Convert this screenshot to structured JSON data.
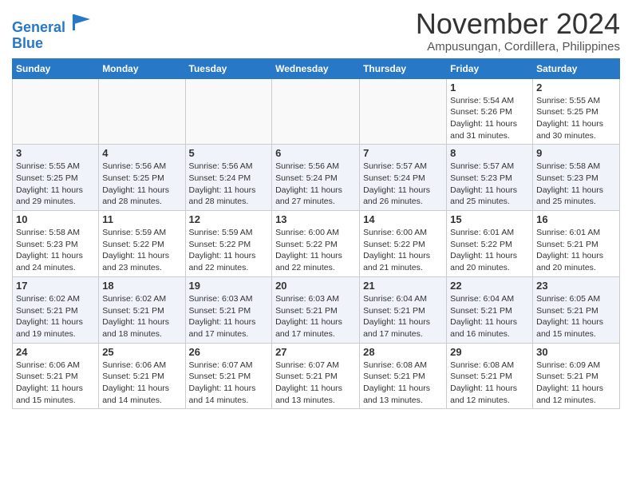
{
  "header": {
    "logo_line1": "General",
    "logo_line2": "Blue",
    "month": "November 2024",
    "location": "Ampusungan, Cordillera, Philippines"
  },
  "days_of_week": [
    "Sunday",
    "Monday",
    "Tuesday",
    "Wednesday",
    "Thursday",
    "Friday",
    "Saturday"
  ],
  "weeks": [
    [
      {
        "day": "",
        "info": ""
      },
      {
        "day": "",
        "info": ""
      },
      {
        "day": "",
        "info": ""
      },
      {
        "day": "",
        "info": ""
      },
      {
        "day": "",
        "info": ""
      },
      {
        "day": "1",
        "info": "Sunrise: 5:54 AM\nSunset: 5:26 PM\nDaylight: 11 hours\nand 31 minutes."
      },
      {
        "day": "2",
        "info": "Sunrise: 5:55 AM\nSunset: 5:25 PM\nDaylight: 11 hours\nand 30 minutes."
      }
    ],
    [
      {
        "day": "3",
        "info": "Sunrise: 5:55 AM\nSunset: 5:25 PM\nDaylight: 11 hours\nand 29 minutes."
      },
      {
        "day": "4",
        "info": "Sunrise: 5:56 AM\nSunset: 5:25 PM\nDaylight: 11 hours\nand 28 minutes."
      },
      {
        "day": "5",
        "info": "Sunrise: 5:56 AM\nSunset: 5:24 PM\nDaylight: 11 hours\nand 28 minutes."
      },
      {
        "day": "6",
        "info": "Sunrise: 5:56 AM\nSunset: 5:24 PM\nDaylight: 11 hours\nand 27 minutes."
      },
      {
        "day": "7",
        "info": "Sunrise: 5:57 AM\nSunset: 5:24 PM\nDaylight: 11 hours\nand 26 minutes."
      },
      {
        "day": "8",
        "info": "Sunrise: 5:57 AM\nSunset: 5:23 PM\nDaylight: 11 hours\nand 25 minutes."
      },
      {
        "day": "9",
        "info": "Sunrise: 5:58 AM\nSunset: 5:23 PM\nDaylight: 11 hours\nand 25 minutes."
      }
    ],
    [
      {
        "day": "10",
        "info": "Sunrise: 5:58 AM\nSunset: 5:23 PM\nDaylight: 11 hours\nand 24 minutes."
      },
      {
        "day": "11",
        "info": "Sunrise: 5:59 AM\nSunset: 5:22 PM\nDaylight: 11 hours\nand 23 minutes."
      },
      {
        "day": "12",
        "info": "Sunrise: 5:59 AM\nSunset: 5:22 PM\nDaylight: 11 hours\nand 22 minutes."
      },
      {
        "day": "13",
        "info": "Sunrise: 6:00 AM\nSunset: 5:22 PM\nDaylight: 11 hours\nand 22 minutes."
      },
      {
        "day": "14",
        "info": "Sunrise: 6:00 AM\nSunset: 5:22 PM\nDaylight: 11 hours\nand 21 minutes."
      },
      {
        "day": "15",
        "info": "Sunrise: 6:01 AM\nSunset: 5:22 PM\nDaylight: 11 hours\nand 20 minutes."
      },
      {
        "day": "16",
        "info": "Sunrise: 6:01 AM\nSunset: 5:21 PM\nDaylight: 11 hours\nand 20 minutes."
      }
    ],
    [
      {
        "day": "17",
        "info": "Sunrise: 6:02 AM\nSunset: 5:21 PM\nDaylight: 11 hours\nand 19 minutes."
      },
      {
        "day": "18",
        "info": "Sunrise: 6:02 AM\nSunset: 5:21 PM\nDaylight: 11 hours\nand 18 minutes."
      },
      {
        "day": "19",
        "info": "Sunrise: 6:03 AM\nSunset: 5:21 PM\nDaylight: 11 hours\nand 17 minutes."
      },
      {
        "day": "20",
        "info": "Sunrise: 6:03 AM\nSunset: 5:21 PM\nDaylight: 11 hours\nand 17 minutes."
      },
      {
        "day": "21",
        "info": "Sunrise: 6:04 AM\nSunset: 5:21 PM\nDaylight: 11 hours\nand 17 minutes."
      },
      {
        "day": "22",
        "info": "Sunrise: 6:04 AM\nSunset: 5:21 PM\nDaylight: 11 hours\nand 16 minutes."
      },
      {
        "day": "23",
        "info": "Sunrise: 6:05 AM\nSunset: 5:21 PM\nDaylight: 11 hours\nand 15 minutes."
      }
    ],
    [
      {
        "day": "24",
        "info": "Sunrise: 6:06 AM\nSunset: 5:21 PM\nDaylight: 11 hours\nand 15 minutes."
      },
      {
        "day": "25",
        "info": "Sunrise: 6:06 AM\nSunset: 5:21 PM\nDaylight: 11 hours\nand 14 minutes."
      },
      {
        "day": "26",
        "info": "Sunrise: 6:07 AM\nSunset: 5:21 PM\nDaylight: 11 hours\nand 14 minutes."
      },
      {
        "day": "27",
        "info": "Sunrise: 6:07 AM\nSunset: 5:21 PM\nDaylight: 11 hours\nand 13 minutes."
      },
      {
        "day": "28",
        "info": "Sunrise: 6:08 AM\nSunset: 5:21 PM\nDaylight: 11 hours\nand 13 minutes."
      },
      {
        "day": "29",
        "info": "Sunrise: 6:08 AM\nSunset: 5:21 PM\nDaylight: 11 hours\nand 12 minutes."
      },
      {
        "day": "30",
        "info": "Sunrise: 6:09 AM\nSunset: 5:21 PM\nDaylight: 11 hours\nand 12 minutes."
      }
    ]
  ]
}
